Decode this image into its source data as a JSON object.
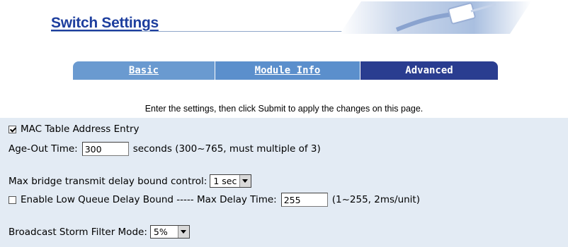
{
  "header": {
    "title": "Switch Settings"
  },
  "tabs": [
    {
      "label": "Basic"
    },
    {
      "label": "Module Info"
    },
    {
      "label": "Advanced"
    }
  ],
  "instructions": "Enter the settings, then click Submit to apply the changes on this page.",
  "form": {
    "mac_table": {
      "label": "MAC Table Address Entry",
      "checked": true
    },
    "age_out": {
      "label": "Age-Out Time:",
      "value": "300",
      "suffix": "seconds (300~765, must multiple of 3)"
    },
    "max_bridge": {
      "label": "Max bridge transmit delay bound control:",
      "value": "1 sec"
    },
    "low_queue": {
      "label": "Enable Low Queue Delay Bound ----- Max Delay Time:",
      "checked": false,
      "value": "255",
      "suffix": "(1~255, 2ms/unit)"
    },
    "broadcast": {
      "label": "Broadcast Storm Filter Mode:",
      "value": "5%"
    }
  },
  "colors": {
    "title": "#1d3e9e",
    "tab_inactive": "#6a9ad0",
    "tab_active": "#2a3d90",
    "panel": "#e3ebf4"
  }
}
